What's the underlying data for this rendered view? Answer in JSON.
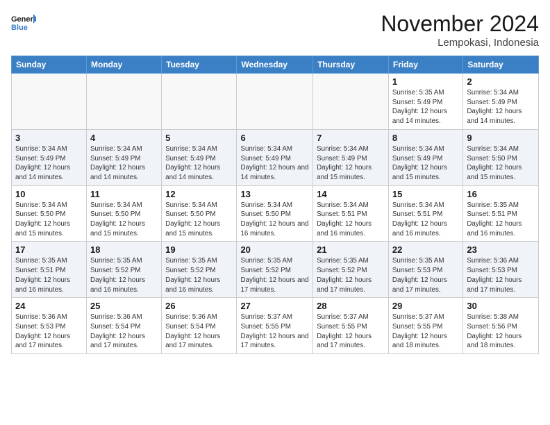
{
  "logo": {
    "line1": "General",
    "line2": "Blue"
  },
  "title": "November 2024",
  "location": "Lempokasi, Indonesia",
  "days_of_week": [
    "Sunday",
    "Monday",
    "Tuesday",
    "Wednesday",
    "Thursday",
    "Friday",
    "Saturday"
  ],
  "weeks": [
    [
      {
        "day": "",
        "empty": true
      },
      {
        "day": "",
        "empty": true
      },
      {
        "day": "",
        "empty": true
      },
      {
        "day": "",
        "empty": true
      },
      {
        "day": "",
        "empty": true
      },
      {
        "day": "1",
        "sunrise": "Sunrise: 5:35 AM",
        "sunset": "Sunset: 5:49 PM",
        "daylight": "Daylight: 12 hours and 14 minutes."
      },
      {
        "day": "2",
        "sunrise": "Sunrise: 5:34 AM",
        "sunset": "Sunset: 5:49 PM",
        "daylight": "Daylight: 12 hours and 14 minutes."
      }
    ],
    [
      {
        "day": "3",
        "sunrise": "Sunrise: 5:34 AM",
        "sunset": "Sunset: 5:49 PM",
        "daylight": "Daylight: 12 hours and 14 minutes."
      },
      {
        "day": "4",
        "sunrise": "Sunrise: 5:34 AM",
        "sunset": "Sunset: 5:49 PM",
        "daylight": "Daylight: 12 hours and 14 minutes."
      },
      {
        "day": "5",
        "sunrise": "Sunrise: 5:34 AM",
        "sunset": "Sunset: 5:49 PM",
        "daylight": "Daylight: 12 hours and 14 minutes."
      },
      {
        "day": "6",
        "sunrise": "Sunrise: 5:34 AM",
        "sunset": "Sunset: 5:49 PM",
        "daylight": "Daylight: 12 hours and 14 minutes."
      },
      {
        "day": "7",
        "sunrise": "Sunrise: 5:34 AM",
        "sunset": "Sunset: 5:49 PM",
        "daylight": "Daylight: 12 hours and 15 minutes."
      },
      {
        "day": "8",
        "sunrise": "Sunrise: 5:34 AM",
        "sunset": "Sunset: 5:49 PM",
        "daylight": "Daylight: 12 hours and 15 minutes."
      },
      {
        "day": "9",
        "sunrise": "Sunrise: 5:34 AM",
        "sunset": "Sunset: 5:50 PM",
        "daylight": "Daylight: 12 hours and 15 minutes."
      }
    ],
    [
      {
        "day": "10",
        "sunrise": "Sunrise: 5:34 AM",
        "sunset": "Sunset: 5:50 PM",
        "daylight": "Daylight: 12 hours and 15 minutes."
      },
      {
        "day": "11",
        "sunrise": "Sunrise: 5:34 AM",
        "sunset": "Sunset: 5:50 PM",
        "daylight": "Daylight: 12 hours and 15 minutes."
      },
      {
        "day": "12",
        "sunrise": "Sunrise: 5:34 AM",
        "sunset": "Sunset: 5:50 PM",
        "daylight": "Daylight: 12 hours and 15 minutes."
      },
      {
        "day": "13",
        "sunrise": "Sunrise: 5:34 AM",
        "sunset": "Sunset: 5:50 PM",
        "daylight": "Daylight: 12 hours and 16 minutes."
      },
      {
        "day": "14",
        "sunrise": "Sunrise: 5:34 AM",
        "sunset": "Sunset: 5:51 PM",
        "daylight": "Daylight: 12 hours and 16 minutes."
      },
      {
        "day": "15",
        "sunrise": "Sunrise: 5:34 AM",
        "sunset": "Sunset: 5:51 PM",
        "daylight": "Daylight: 12 hours and 16 minutes."
      },
      {
        "day": "16",
        "sunrise": "Sunrise: 5:35 AM",
        "sunset": "Sunset: 5:51 PM",
        "daylight": "Daylight: 12 hours and 16 minutes."
      }
    ],
    [
      {
        "day": "17",
        "sunrise": "Sunrise: 5:35 AM",
        "sunset": "Sunset: 5:51 PM",
        "daylight": "Daylight: 12 hours and 16 minutes."
      },
      {
        "day": "18",
        "sunrise": "Sunrise: 5:35 AM",
        "sunset": "Sunset: 5:52 PM",
        "daylight": "Daylight: 12 hours and 16 minutes."
      },
      {
        "day": "19",
        "sunrise": "Sunrise: 5:35 AM",
        "sunset": "Sunset: 5:52 PM",
        "daylight": "Daylight: 12 hours and 16 minutes."
      },
      {
        "day": "20",
        "sunrise": "Sunrise: 5:35 AM",
        "sunset": "Sunset: 5:52 PM",
        "daylight": "Daylight: 12 hours and 17 minutes."
      },
      {
        "day": "21",
        "sunrise": "Sunrise: 5:35 AM",
        "sunset": "Sunset: 5:52 PM",
        "daylight": "Daylight: 12 hours and 17 minutes."
      },
      {
        "day": "22",
        "sunrise": "Sunrise: 5:35 AM",
        "sunset": "Sunset: 5:53 PM",
        "daylight": "Daylight: 12 hours and 17 minutes."
      },
      {
        "day": "23",
        "sunrise": "Sunrise: 5:36 AM",
        "sunset": "Sunset: 5:53 PM",
        "daylight": "Daylight: 12 hours and 17 minutes."
      }
    ],
    [
      {
        "day": "24",
        "sunrise": "Sunrise: 5:36 AM",
        "sunset": "Sunset: 5:53 PM",
        "daylight": "Daylight: 12 hours and 17 minutes."
      },
      {
        "day": "25",
        "sunrise": "Sunrise: 5:36 AM",
        "sunset": "Sunset: 5:54 PM",
        "daylight": "Daylight: 12 hours and 17 minutes."
      },
      {
        "day": "26",
        "sunrise": "Sunrise: 5:36 AM",
        "sunset": "Sunset: 5:54 PM",
        "daylight": "Daylight: 12 hours and 17 minutes."
      },
      {
        "day": "27",
        "sunrise": "Sunrise: 5:37 AM",
        "sunset": "Sunset: 5:55 PM",
        "daylight": "Daylight: 12 hours and 17 minutes."
      },
      {
        "day": "28",
        "sunrise": "Sunrise: 5:37 AM",
        "sunset": "Sunset: 5:55 PM",
        "daylight": "Daylight: 12 hours and 17 minutes."
      },
      {
        "day": "29",
        "sunrise": "Sunrise: 5:37 AM",
        "sunset": "Sunset: 5:55 PM",
        "daylight": "Daylight: 12 hours and 18 minutes."
      },
      {
        "day": "30",
        "sunrise": "Sunrise: 5:38 AM",
        "sunset": "Sunset: 5:56 PM",
        "daylight": "Daylight: 12 hours and 18 minutes."
      }
    ]
  ]
}
